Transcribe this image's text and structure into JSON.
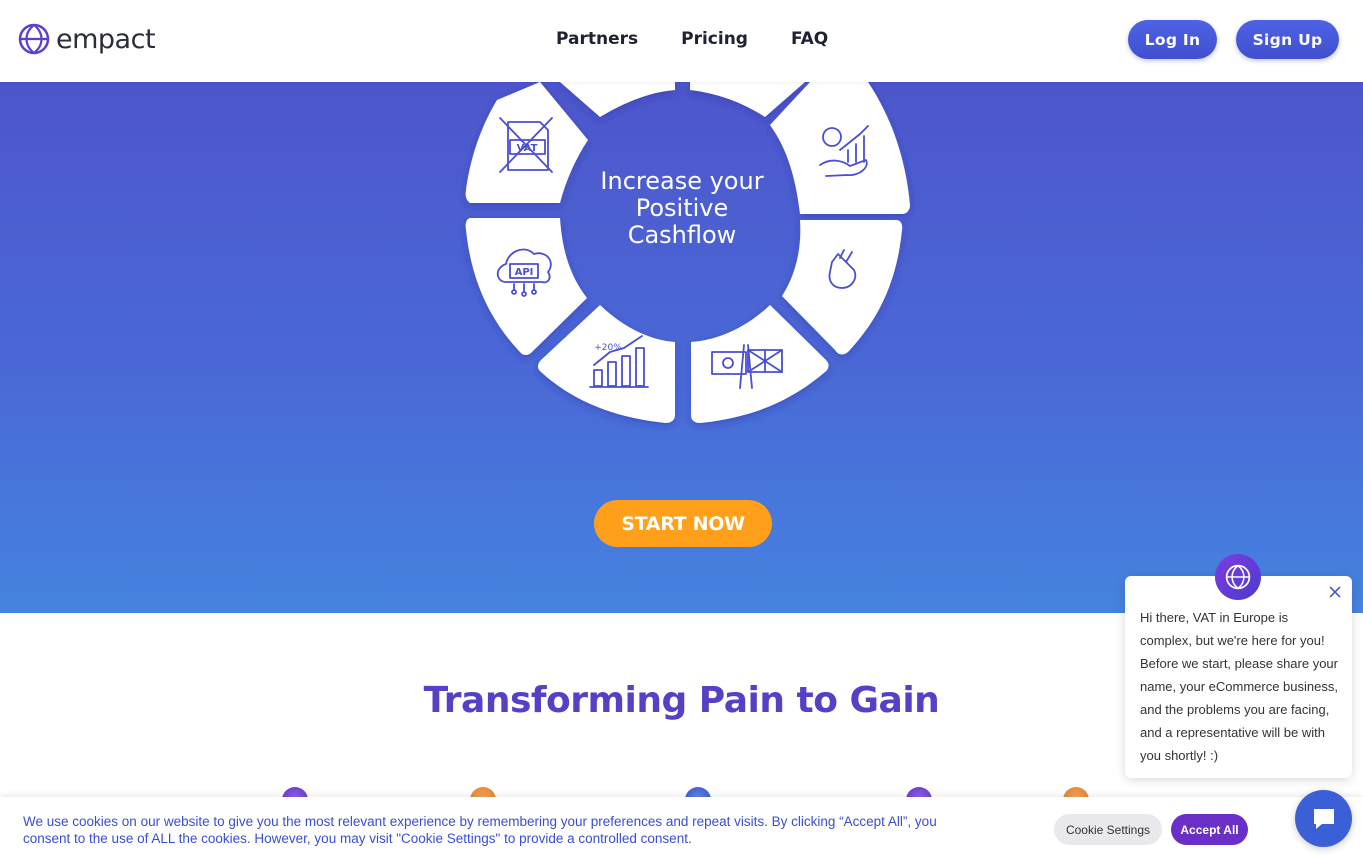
{
  "header": {
    "logo_text": "empact",
    "nav": [
      "Partners",
      "Pricing",
      "FAQ"
    ],
    "login_label": "Log In",
    "signup_label": "Sign Up"
  },
  "hero": {
    "center_lines": [
      "Increase your",
      "Positive",
      "Cashflow"
    ],
    "segment_icons": [
      "vat-crossed-icon",
      "money-growth-hand-icon",
      "hand-gesture-icon",
      "eu-uk-flags-icon",
      "growth-chart-icon",
      "api-cloud-icon"
    ],
    "chart_badge": "+20%",
    "api_badge": "API",
    "vat_badge": "VAT",
    "cta_label": "START NOW"
  },
  "section": {
    "title": "Transforming Pain to Gain"
  },
  "cookie": {
    "text": "We use cookies on our website to give you the most relevant experience by remembering your preferences and repeat visits. By clicking “Accept All”, you consent to the use of ALL the cookies. However, you may visit \"Cookie Settings\" to provide a controlled consent.",
    "settings_label": "Cookie Settings",
    "accept_label": "Accept All"
  },
  "chat": {
    "message": "Hi there, VAT in Europe is complex, but we're here for you! Before we start, please share your name, your eCommerce business, and the problems you are facing, and a representative will be with you shortly! :)"
  },
  "colors": {
    "brand_purple": "#5540c6",
    "button_blue": "#4457d8",
    "cta_orange": "#ff9f1a",
    "accept_purple": "#6a2fc6"
  }
}
